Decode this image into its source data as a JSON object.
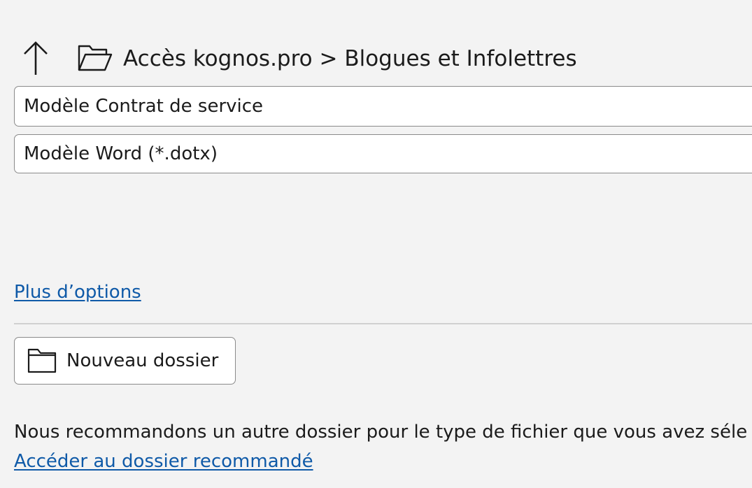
{
  "navigation": {
    "up_icon": "arrow-up-icon",
    "folder_icon": "folder-open-icon",
    "breadcrumb": "Accès kognos.pro > Blogues et Infolettres"
  },
  "form": {
    "filename_value": "Modèle Contrat de service",
    "filetype_value": "Modèle Word (*.dotx)"
  },
  "links": {
    "more_options": "Plus d’options",
    "recommended_folder": "Accéder au dossier recommandé"
  },
  "buttons": {
    "new_folder_label": "Nouveau dossier",
    "new_folder_icon": "folder-icon"
  },
  "messages": {
    "recommendation": "Nous recommandons un autre dossier pour le type de fichier que vous avez séle"
  },
  "colors": {
    "background": "#f3f3f3",
    "link": "#0f5aa8",
    "border": "#8a8a8a",
    "text": "#1b1b1b"
  }
}
